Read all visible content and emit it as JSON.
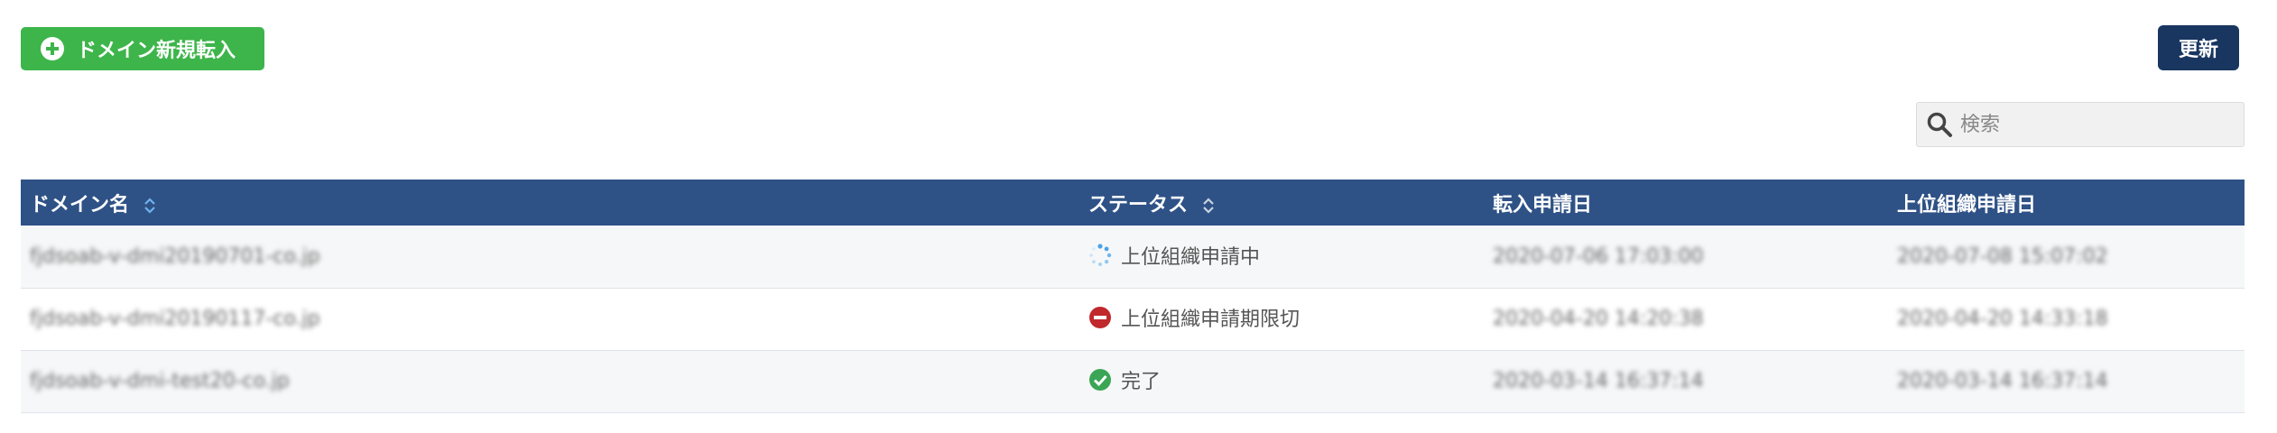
{
  "toolbar": {
    "transfer_button_label": "ドメイン新規転入",
    "refresh_button_label": "更新"
  },
  "search": {
    "placeholder": "検索",
    "value": ""
  },
  "table": {
    "columns": [
      "ドメイン名",
      "ステータス",
      "転入申請日",
      "上位組織申請日"
    ],
    "rows": [
      {
        "domain": "fjdsoab-v-dmi20190701-co.jp",
        "status": "上位組織申請中",
        "status_icon": "loading-spinner-icon",
        "transfer_date": "2020-07-06 17:03:00",
        "upper_date": "2020-07-08 15:07:02"
      },
      {
        "domain": "fjdsoab-v-dmi20190117-co.jp",
        "status": "上位組織申請期限切",
        "status_icon": "minus-circle-icon",
        "transfer_date": "2020-04-20 14:20:38",
        "upper_date": "2020-04-20 14:33:18"
      },
      {
        "domain": "fjdsoab-v-dmi-test20-co.jp",
        "status": "完了",
        "status_icon": "check-circle-icon",
        "transfer_date": "2020-03-14 16:37:14",
        "upper_date": "2020-03-14 16:37:14"
      }
    ]
  },
  "colors": {
    "primary_green": "#3db54a",
    "navy": "#183660",
    "header_blue": "#2f5286",
    "spinner_blue": "#4aa3e8",
    "error_red": "#c0282d",
    "success_green": "#3aa655"
  }
}
